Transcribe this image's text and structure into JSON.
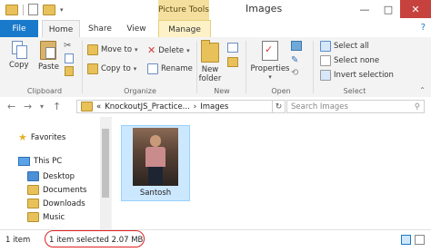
{
  "window": {
    "title": "Images",
    "context_tab_header": "Picture Tools",
    "minimize": "—",
    "maximize": "□",
    "close": "✕"
  },
  "tabs": {
    "file": "File",
    "home": "Home",
    "share": "Share",
    "view": "View",
    "manage": "Manage",
    "help": "?"
  },
  "ribbon": {
    "clipboard": {
      "copy": "Copy",
      "paste": "Paste",
      "label": "Clipboard"
    },
    "organize": {
      "move_to": "Move to",
      "copy_to": "Copy to",
      "delete": "Delete",
      "rename": "Rename",
      "label": "Organize"
    },
    "new": {
      "new_folder_line1": "New",
      "new_folder_line2": "folder",
      "label": "New"
    },
    "open": {
      "properties": "Properties",
      "label": "Open"
    },
    "select": {
      "select_all": "Select all",
      "select_none": "Select none",
      "invert_selection": "Invert selection",
      "label": "Select"
    }
  },
  "address": {
    "overflow": "«",
    "crumb1": "KnockoutJS_Practice...",
    "sep": "›",
    "crumb2": "Images",
    "refresh": "↻",
    "search_placeholder": "Search Images",
    "search_icon": "⚲"
  },
  "nav": {
    "favorites": "Favorites",
    "this_pc": "This PC",
    "items": [
      "Desktop",
      "Documents",
      "Downloads",
      "Music"
    ]
  },
  "files": [
    {
      "name": "Santosh"
    }
  ],
  "status": {
    "count": "1 item",
    "selected": "1 item selected  2.07 MB"
  },
  "colors": {
    "accent": "#1979ca",
    "context_tab": "#f5df9f",
    "selection": "#cce8ff",
    "annotation": "#e02020"
  }
}
